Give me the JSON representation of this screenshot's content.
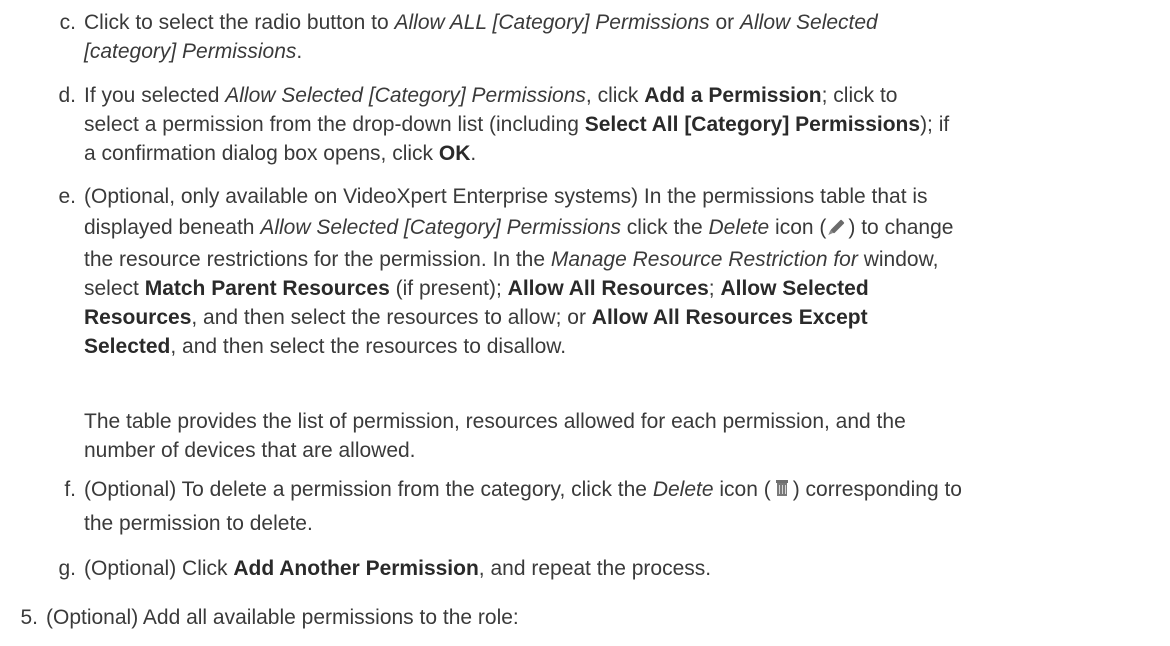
{
  "steps": {
    "c": {
      "marker": "c.",
      "t1": "Click to select the radio button to ",
      "i1": "Allow ALL [Category] Permissions",
      "t2": " or ",
      "i2a": "Allow Selected",
      "i2b": "[category] Permissions",
      "t3": "."
    },
    "d": {
      "marker": "d.",
      "t1": "If you selected ",
      "i1": "Allow Selected [Category] Permissions",
      "t2": ", click ",
      "b1": "Add a Permission",
      "t3": "; click to",
      "t4": "select a permission from the drop-down list (including ",
      "b2": "Select All [Category] Permissions",
      "t5": "); if",
      "t6": "a confirmation dialog box opens, click ",
      "b3": "OK",
      "t7": "."
    },
    "e": {
      "marker": "e.",
      "t1": "(Optional, only available on VideoXpert Enterprise systems) In the permissions table that is",
      "t2": "displayed beneath ",
      "i1": "Allow Selected [Category] Permissions",
      "t3": " click the ",
      "i2": "Delete",
      "t4": " icon (",
      "icon": "pencil-icon",
      "t5": ") to change",
      "t6": "the resource restrictions for the permission. In the ",
      "i3": "Manage Resource Restriction for",
      "t7": " window,",
      "t8": "select ",
      "b1": "Match Parent Resources",
      "t9": " (if present); ",
      "b2": "Allow All Resources",
      "t10": "; ",
      "b3": "Allow Selected",
      "b4": "Resources",
      "t11": ", and then select the resources to allow; or ",
      "b5": "Allow All Resources Except",
      "b6": "Selected",
      "t12": ", and then select the resources to disallow."
    },
    "e_note": {
      "l1": "The table provides the list of permission, resources allowed for each permission, and the",
      "l2": "number of devices that are allowed."
    },
    "f": {
      "marker": "f.",
      "t1": "(Optional) To delete a permission from the category, click the ",
      "i1": "Delete",
      "t2": " icon (",
      "icon": "trash-icon",
      "t3": ") corresponding to",
      "t4": "the permission to delete."
    },
    "g": {
      "marker": "g.",
      "t1": "(Optional) Click ",
      "b1": "Add Another Permission",
      "t2": ", and repeat the process."
    },
    "five": {
      "marker": "5.",
      "text": "(Optional) Add all available permissions to the role:"
    }
  }
}
